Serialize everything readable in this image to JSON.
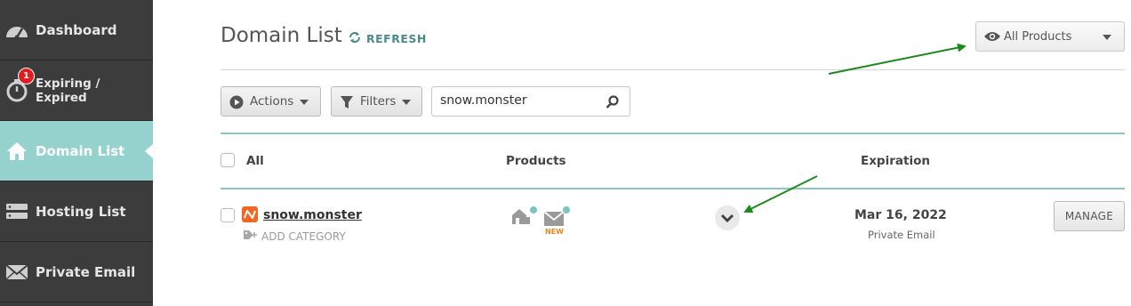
{
  "sidebar": {
    "items": [
      {
        "label": "Dashboard",
        "icon": "speedometer-icon"
      },
      {
        "label": "Expiring / Expired",
        "icon": "stopwatch-icon",
        "badge": "1"
      },
      {
        "label": "Domain List",
        "icon": "home-icon",
        "active": true
      },
      {
        "label": "Hosting List",
        "icon": "server-icon"
      },
      {
        "label": "Private Email",
        "icon": "envelope-icon"
      }
    ]
  },
  "header": {
    "title": "Domain List",
    "refresh_label": "REFRESH",
    "product_filter": "All Products"
  },
  "toolbar": {
    "actions_label": "Actions",
    "filters_label": "Filters",
    "search_value": "snow.monster"
  },
  "table": {
    "columns": {
      "all": "All",
      "products": "Products",
      "expiration": "Expiration"
    },
    "rows": [
      {
        "domain": "snow.monster",
        "add_category": "ADD CATEGORY",
        "products": [
          "hosting-icon",
          "email-icon"
        ],
        "new_tag": "NEW",
        "expiration_date": "Mar 16, 2022",
        "expiration_note": "Private Email",
        "manage_label": "MANAGE"
      }
    ]
  },
  "colors": {
    "sidebar_bg": "#3c3c3c",
    "active_item": "#96d2cd",
    "accent_teal": "#4a8a8c",
    "brand_orange": "#f26522",
    "arrow_green": "#1a8a1a"
  }
}
